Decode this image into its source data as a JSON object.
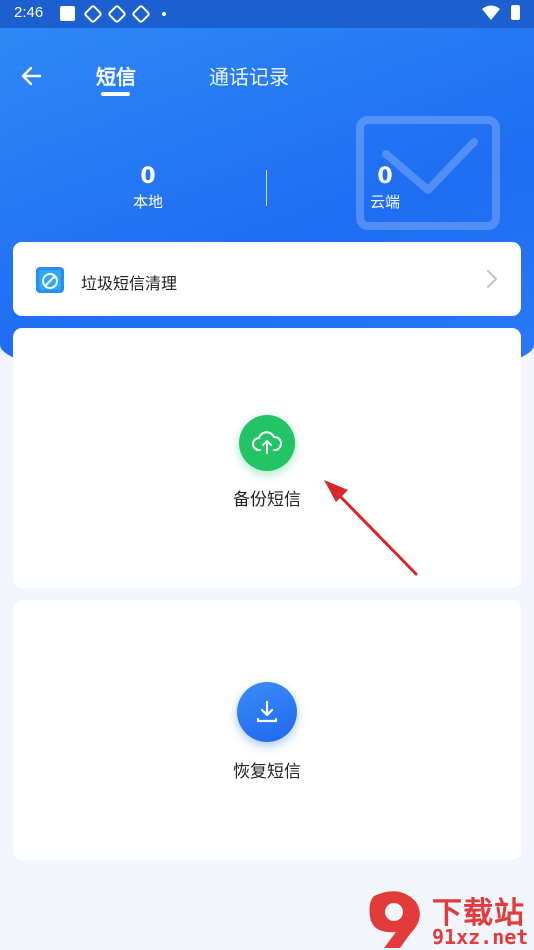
{
  "status_bar": {
    "time": "2:46"
  },
  "header": {
    "tabs": [
      {
        "label": "短信",
        "active": true
      },
      {
        "label": "通话记录",
        "active": false
      }
    ]
  },
  "stats": {
    "local": {
      "value": "0",
      "label": "本地"
    },
    "cloud": {
      "value": "0",
      "label": "云端"
    }
  },
  "spam_card": {
    "label": "垃圾短信清理"
  },
  "backup": {
    "label": "备份短信",
    "icon": "cloud-upload-icon"
  },
  "restore": {
    "label": "恢复短信",
    "icon": "download-icon"
  },
  "watermark": {
    "line1": "下载站",
    "line2": "91xz.net"
  },
  "colors": {
    "primary_blue": "#2f80f6",
    "backup_green": "#22c466",
    "restore_blue": "#1f67ee",
    "annotation_red": "#d92626"
  }
}
